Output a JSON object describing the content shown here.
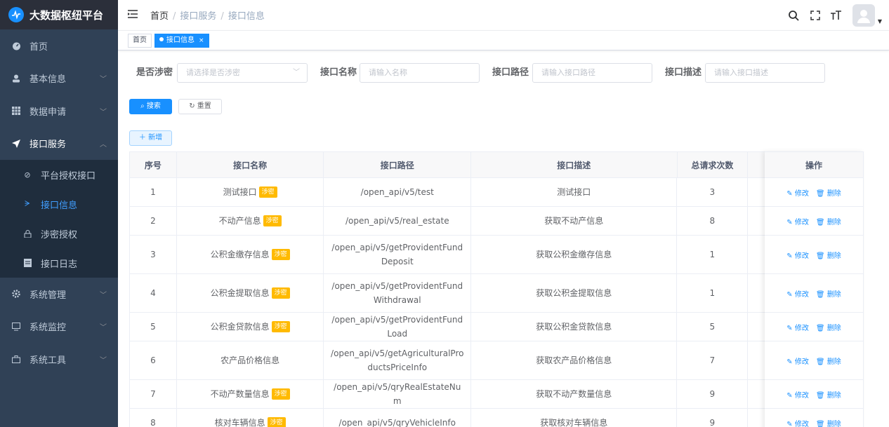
{
  "app": {
    "title": "大数据枢纽平台"
  },
  "sidebar": {
    "items": [
      {
        "label": "首页",
        "icon": "dashboard-icon"
      },
      {
        "label": "基本信息",
        "icon": "user-icon"
      },
      {
        "label": "数据申请",
        "icon": "table-icon"
      },
      {
        "label": "接口服务",
        "icon": "send-icon"
      },
      {
        "label": "系统管理",
        "icon": "gear-icon"
      },
      {
        "label": "系统监控",
        "icon": "monitor-icon"
      },
      {
        "label": "系统工具",
        "icon": "toolbox-icon"
      }
    ],
    "submenu": [
      {
        "label": "平台授权接口",
        "icon": "shield-icon"
      },
      {
        "label": "接口信息",
        "icon": "tree-icon"
      },
      {
        "label": "涉密授权",
        "icon": "lock-icon"
      },
      {
        "label": "接口日志",
        "icon": "log-icon"
      }
    ]
  },
  "breadcrumb": {
    "home": "首页",
    "level1": "接口服务",
    "level2": "接口信息"
  },
  "tags": {
    "home": "首页",
    "active": "接口信息",
    "close": "×"
  },
  "filters": {
    "secret_label": "是否涉密",
    "secret_placeholder": "请选择是否涉密",
    "name_label": "接口名称",
    "name_placeholder": "请输入名称",
    "path_label": "接口路径",
    "path_placeholder": "请输入接口路径",
    "desc_label": "接口描述",
    "desc_placeholder": "请输入接口描述"
  },
  "buttons": {
    "search": "搜索",
    "reset": "重置",
    "add": "新增"
  },
  "table": {
    "headers": [
      "序号",
      "接口名称",
      "接口路径",
      "接口描述",
      "总请求次数",
      "操作"
    ],
    "secret_tag": "涉密",
    "edit_label": "修改",
    "delete_label": "删除",
    "rows": [
      {
        "no": "1",
        "name": "测试接口",
        "secret": true,
        "path": "/open_api/v5/test",
        "desc": "测试接口",
        "count": "3"
      },
      {
        "no": "2",
        "name": "不动产信息",
        "secret": true,
        "path": "/open_api/v5/real_estate",
        "desc": "获取不动产信息",
        "count": "8"
      },
      {
        "no": "3",
        "name": "公积金缴存信息",
        "secret": true,
        "path": "/open_api/v5/getProvidentFundDeposit",
        "desc": "获取公积金缴存信息",
        "count": "1"
      },
      {
        "no": "4",
        "name": "公积金提取信息",
        "secret": true,
        "path": "/open_api/v5/getProvidentFundWithdrawal",
        "desc": "获取公积金提取信息",
        "count": "1"
      },
      {
        "no": "5",
        "name": "公积金贷款信息",
        "secret": true,
        "path": "/open_api/v5/getProvidentFundLoad",
        "desc": "获取公积金贷款信息",
        "count": "5"
      },
      {
        "no": "6",
        "name": "农产品价格信息",
        "secret": false,
        "path": "/open_api/v5/getAgriculturalProductsPriceInfo",
        "desc": "获取农产品价格信息",
        "count": "7"
      },
      {
        "no": "7",
        "name": "不动产数量信息",
        "secret": true,
        "path": "/open_api/v5/qryRealEstateNum",
        "desc": "获取不动产数量信息",
        "count": "9"
      },
      {
        "no": "8",
        "name": "核对车辆信息",
        "secret": true,
        "path": "/open_api/v5/qryVehicleInfo",
        "desc": "获取核对车辆信息",
        "count": "9"
      }
    ]
  },
  "colors": {
    "sidebar_bg": "#304156",
    "accent": "#1890ff",
    "secret_tag": "#ffba00"
  }
}
